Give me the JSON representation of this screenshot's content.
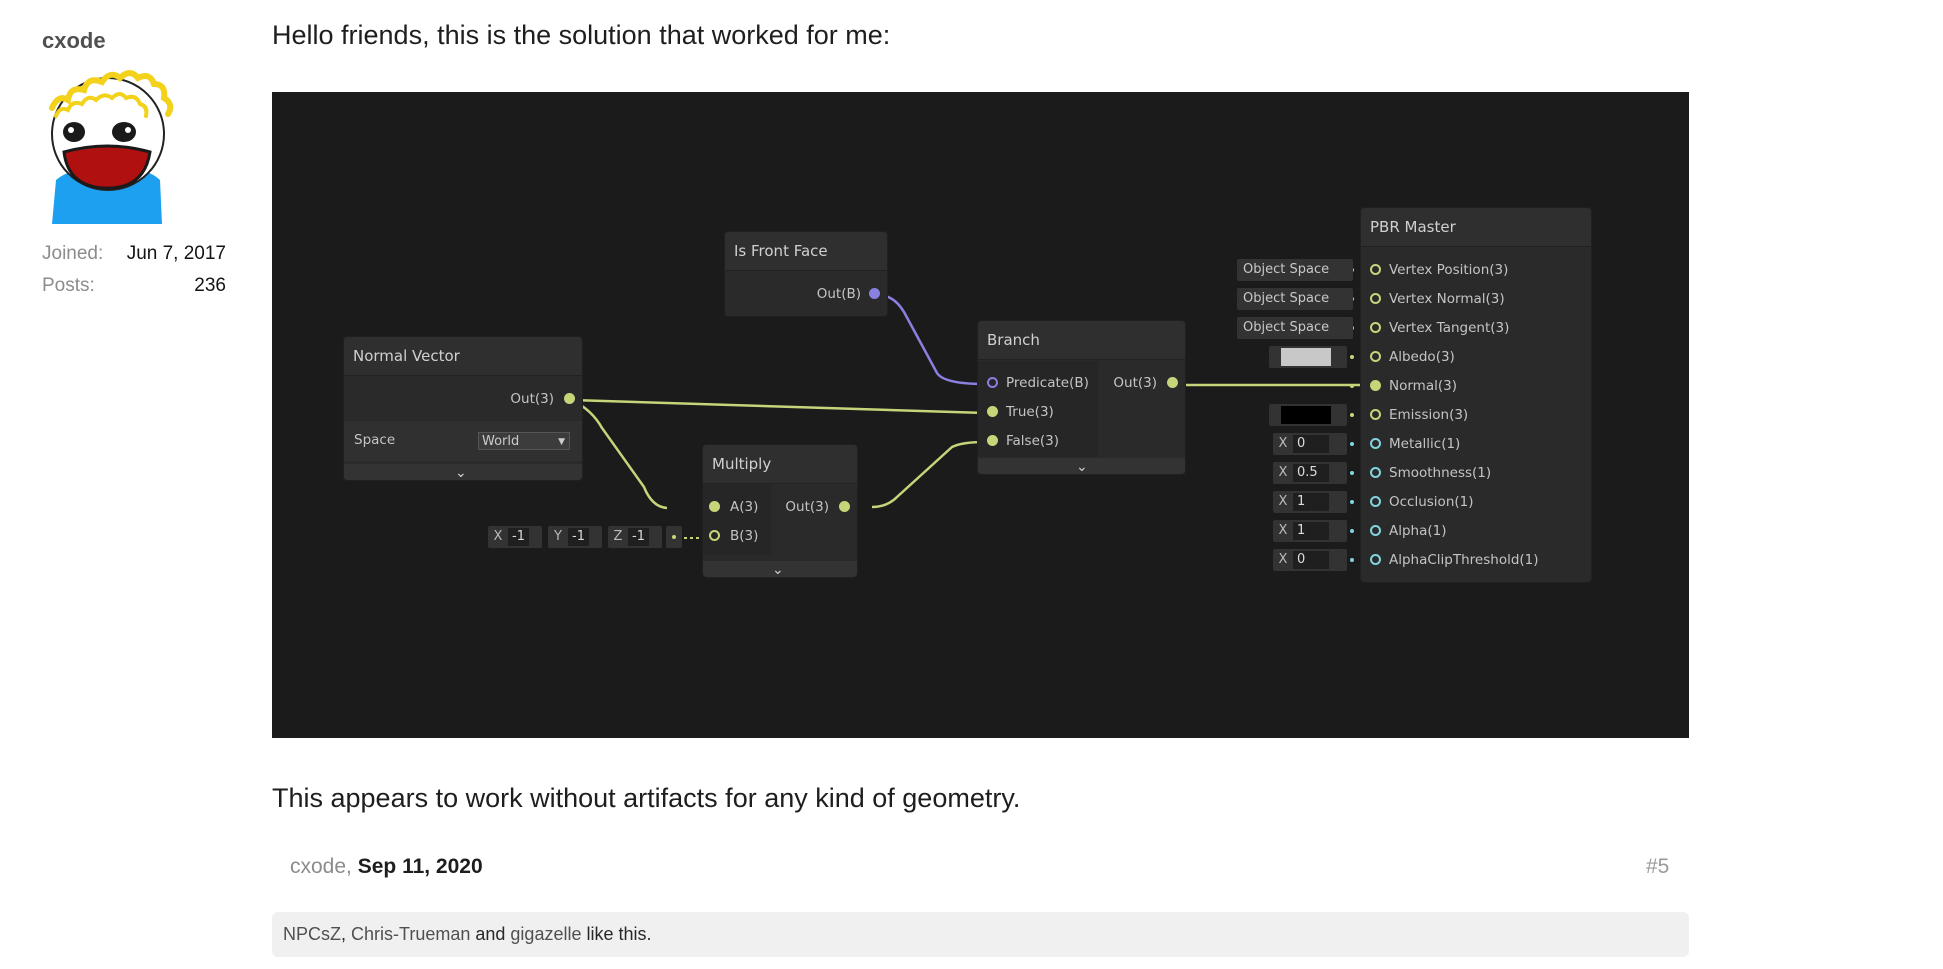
{
  "user": {
    "name": "cxode",
    "joined_label": "Joined:",
    "joined_value": "Jun 7, 2017",
    "posts_label": "Posts:",
    "posts_value": "236"
  },
  "post": {
    "intro": "Hello friends, this is the solution that worked for me:",
    "outro": "This appears to work without artifacts for any kind of geometry.",
    "author": "cxode,",
    "date": "Sep 11, 2020",
    "number": "#5",
    "likes": {
      "u1": "NPCsZ",
      "sep1": ", ",
      "u2": "Chris-Trueman",
      "and": " and ",
      "u3": "gigazelle",
      "suffix": " like this."
    }
  },
  "graph": {
    "colors": {
      "background": "#1b1b1b",
      "wire_vector": "#c8d47a",
      "wire_bool": "#8a80e0",
      "port_float": "#82d4e0"
    },
    "normal_vector": {
      "title": "Normal Vector",
      "out": "Out(3)",
      "space_label": "Space",
      "space_value": "World"
    },
    "is_front_face": {
      "title": "Is Front Face",
      "out": "Out(B)"
    },
    "multiply": {
      "title": "Multiply",
      "in_a": "A(3)",
      "in_b": "B(3)",
      "out": "Out(3)",
      "bx_label": "X",
      "bx": "-1",
      "by_label": "Y",
      "by": "-1",
      "bz_label": "Z",
      "bz": "-1"
    },
    "branch": {
      "title": "Branch",
      "predicate": "Predicate(B)",
      "true_in": "True(3)",
      "false_in": "False(3)",
      "out": "Out(3)"
    },
    "pbr_master": {
      "title": "PBR Master",
      "ports": [
        "Vertex Position(3)",
        "Vertex Normal(3)",
        "Vertex Tangent(3)",
        "Albedo(3)",
        "Normal(3)",
        "Emission(3)",
        "Metallic(1)",
        "Smoothness(1)",
        "Occlusion(1)",
        "Alpha(1)",
        "AlphaClipThreshold(1)"
      ],
      "space_fields": [
        "Object Space",
        "Object Space",
        "Object Space"
      ],
      "albedo_color": "#c8c8c8",
      "emission_color": "#000000",
      "float_axis": "X",
      "float_values": [
        "0",
        "0.5",
        "1",
        "1",
        "0"
      ]
    }
  }
}
